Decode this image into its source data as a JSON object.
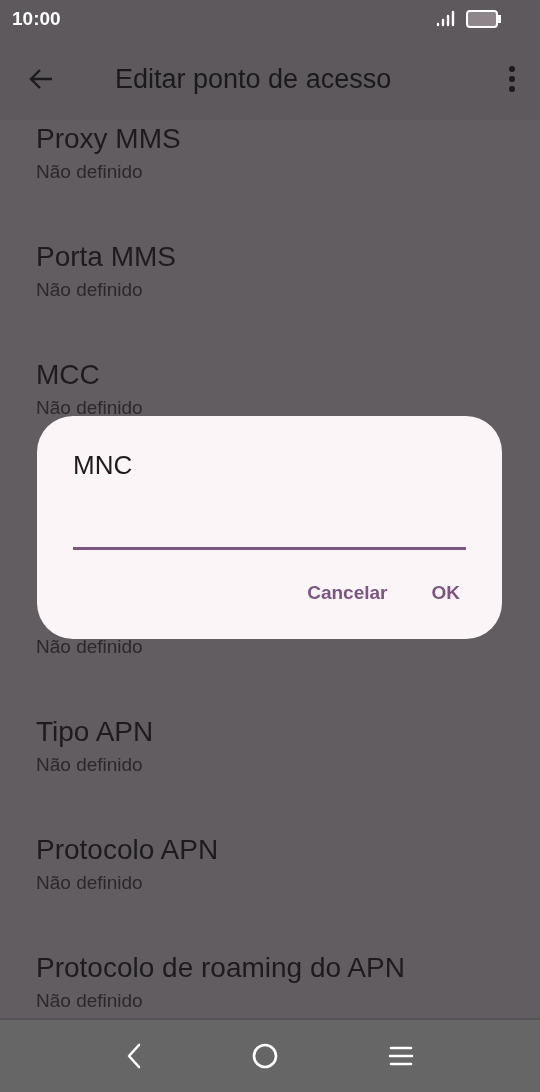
{
  "status_bar": {
    "time": "10:00"
  },
  "app_bar": {
    "title": "Editar ponto de acesso"
  },
  "settings": [
    {
      "title": "Proxy MMS",
      "summary": "Não definido"
    },
    {
      "title": "Porta MMS",
      "summary": "Não definido"
    },
    {
      "title": "MCC",
      "summary": "Não definido"
    },
    {
      "summary": "Não definido"
    },
    {
      "title": "Tipo APN",
      "summary": "Não definido"
    },
    {
      "title": "Protocolo APN",
      "summary": "Não definido"
    },
    {
      "title": "Protocolo de roaming do APN",
      "summary": "Não definido"
    }
  ],
  "dialog": {
    "title": "MNC",
    "buttons": [
      "Cancelar",
      "OK"
    ]
  }
}
